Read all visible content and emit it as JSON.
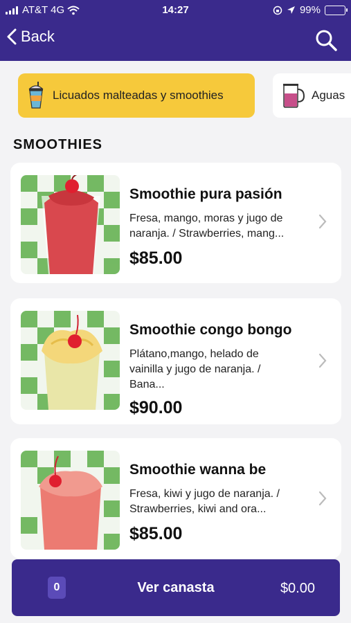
{
  "status_bar": {
    "carrier": "AT&T 4G",
    "time": "14:27",
    "battery": "99%",
    "battery_level": 0.99
  },
  "nav": {
    "back_label": "Back",
    "icons": {
      "back": "chevron-left-icon",
      "search": "search-icon"
    }
  },
  "categories": [
    {
      "label": "Licuados malteadas y smoothies",
      "icon": "smoothie-cup-icon",
      "selected": true
    },
    {
      "label": "Aguas",
      "icon": "water-jug-icon",
      "selected": false
    }
  ],
  "section": {
    "title": "SMOOTHIES"
  },
  "products": [
    {
      "name": "Smoothie pura pasión",
      "desc_lines": [
        "Fresa, mango, moras y jugo de",
        "naranja. / Strawberries, mang..."
      ],
      "price": "$85.00",
      "color": "#d9484e"
    },
    {
      "name": "Smoothie congo bongo",
      "desc_lines": [
        "Plátano,mango, helado de",
        "vainilla y jugo de naranja. /",
        "Bana..."
      ],
      "price": "$90.00",
      "color": "#f4d77a"
    },
    {
      "name": "Smoothie wanna be",
      "desc_lines": [
        "Fresa, kiwi y jugo de naranja. /",
        "Strawberries, kiwi and ora..."
      ],
      "price": "$85.00",
      "color": "#ec7b72"
    }
  ],
  "cart": {
    "count": "0",
    "label": "Ver canasta",
    "total": "$0.00"
  },
  "colors": {
    "brand": "#3a2a8c",
    "accent": "#f6c93b",
    "background": "#f3f3f5"
  }
}
